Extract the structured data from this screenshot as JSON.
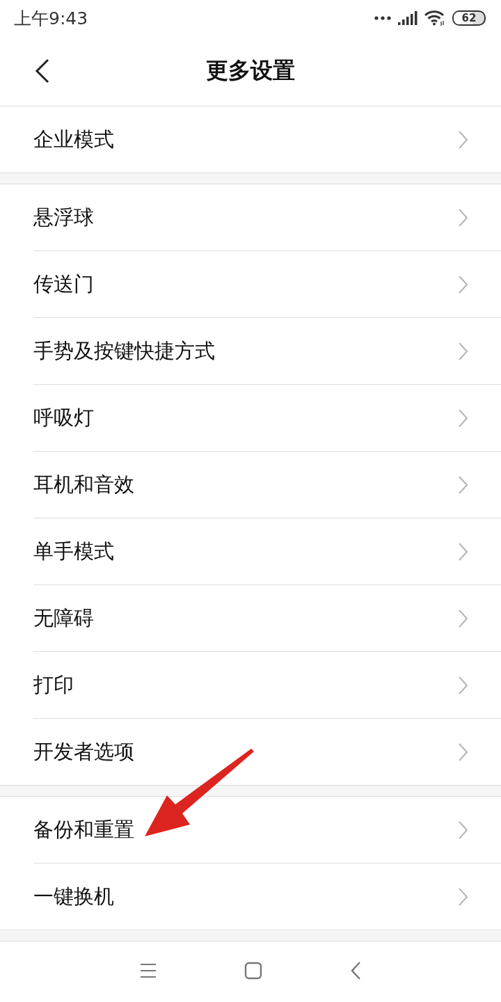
{
  "status_bar": {
    "time": "上午9:43",
    "battery": "62"
  },
  "header": {
    "title": "更多设置"
  },
  "groups": [
    {
      "items": [
        {
          "label": "企业模式",
          "arrow": false
        }
      ]
    },
    {
      "items": [
        {
          "label": "悬浮球",
          "arrow": false
        },
        {
          "label": "传送门",
          "arrow": false
        },
        {
          "label": "手势及按键快捷方式",
          "arrow": false
        },
        {
          "label": "呼吸灯",
          "arrow": false
        },
        {
          "label": "耳机和音效",
          "arrow": false
        },
        {
          "label": "单手模式",
          "arrow": false
        },
        {
          "label": "无障碍",
          "arrow": false
        },
        {
          "label": "打印",
          "arrow": false
        },
        {
          "label": "开发者选项",
          "arrow": false
        }
      ]
    },
    {
      "items": [
        {
          "label": "备份和重置",
          "arrow": true
        },
        {
          "label": "一键换机",
          "arrow": false
        }
      ]
    }
  ]
}
